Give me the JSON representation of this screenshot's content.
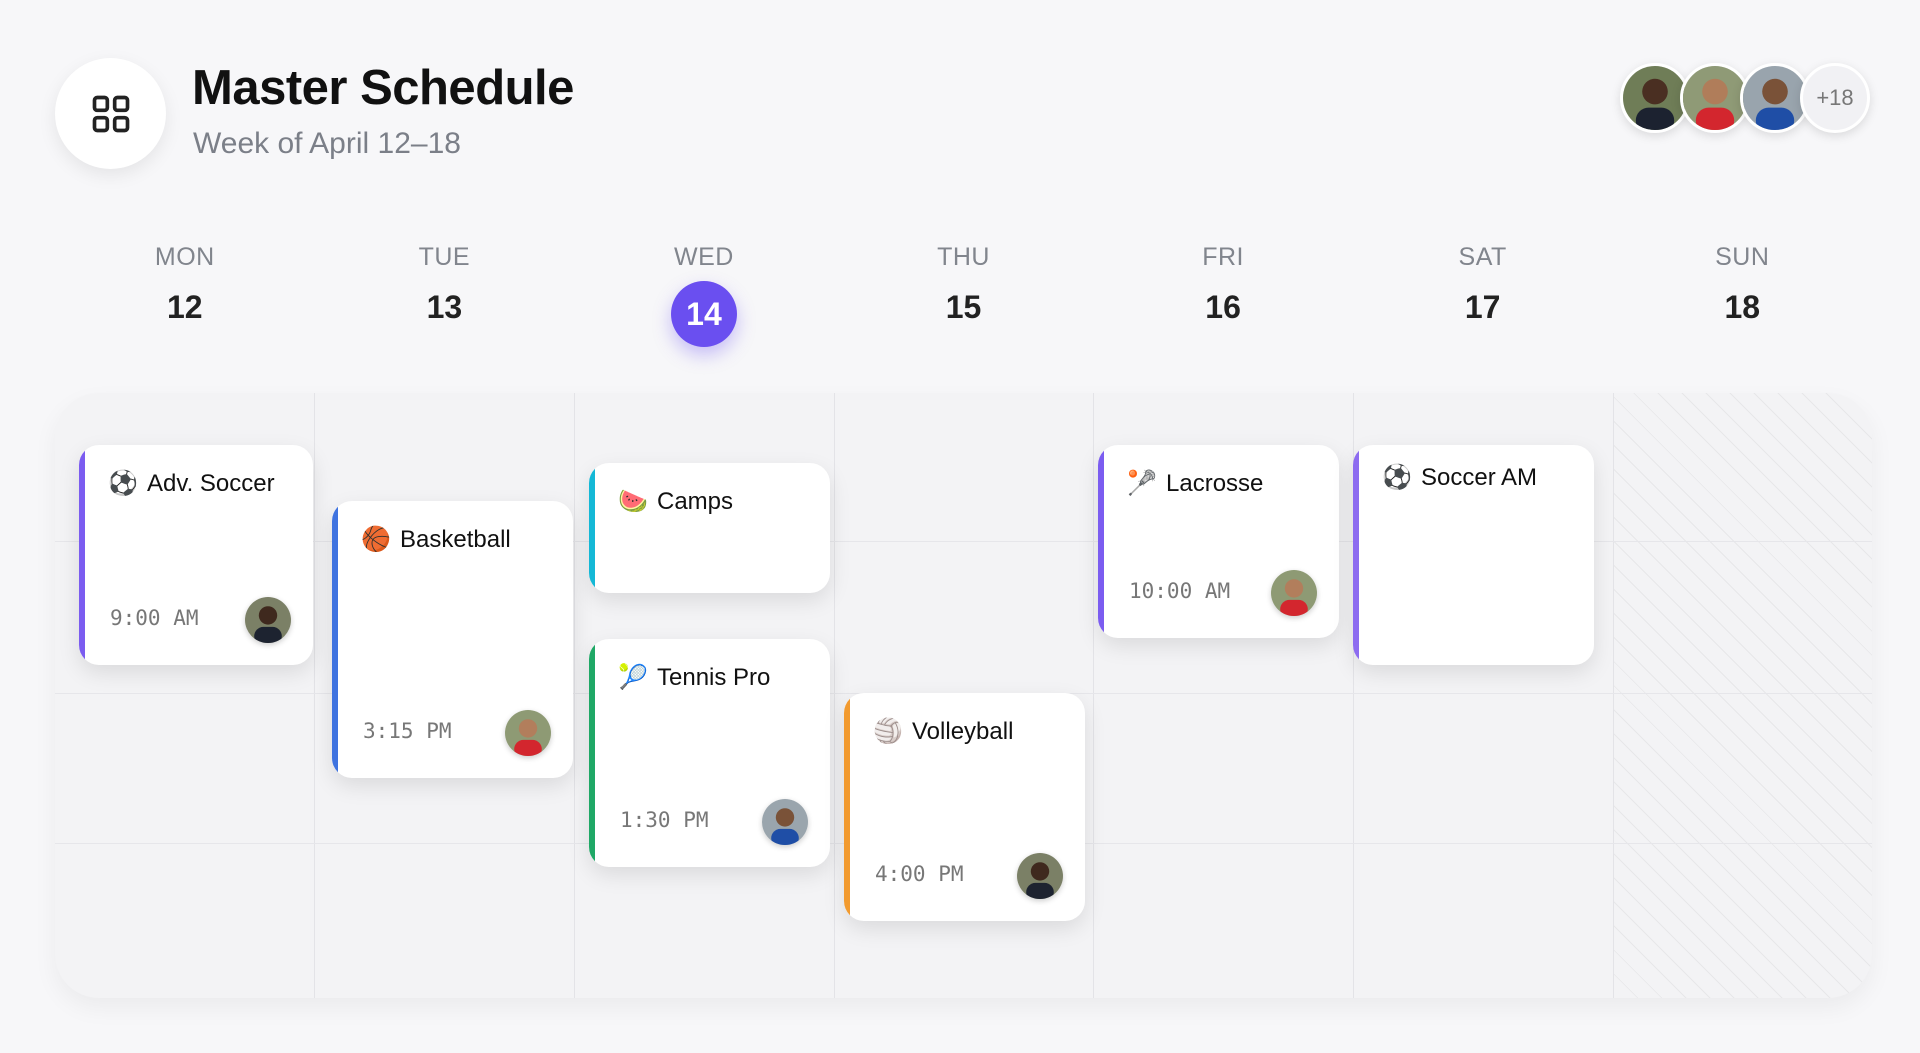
{
  "header": {
    "title": "Master Schedule",
    "subtitle": "Week of April 12–18",
    "more_count": "+18"
  },
  "colors": {
    "today": "#6a4ff0",
    "accent_purple": "#7b5cf0",
    "accent_blue": "#3f73e0",
    "accent_cyan": "#14b8d6",
    "accent_green": "#1fa866",
    "accent_orange": "#f29a2e",
    "accent_violet": "#8d6cf0"
  },
  "days": [
    {
      "name": "MON",
      "num": "12"
    },
    {
      "name": "TUE",
      "num": "13"
    },
    {
      "name": "WED",
      "num": "14"
    },
    {
      "name": "THU",
      "num": "15"
    },
    {
      "name": "FRI",
      "num": "16"
    },
    {
      "name": "SAT",
      "num": "17"
    },
    {
      "name": "SUN",
      "num": "18"
    }
  ],
  "events": {
    "adv_soccer": {
      "title": "Adv. Soccer",
      "time": "9:00 AM",
      "icon": "soccer-ball-icon"
    },
    "basketball": {
      "title": "Basketball",
      "time": "3:15 PM",
      "icon": "basketball-icon"
    },
    "camps": {
      "title": "Camps",
      "icon": "watermelon-icon"
    },
    "tennis": {
      "title": "Tennis Pro",
      "time": "1:30 PM",
      "icon": "tennis-ball-icon"
    },
    "volleyball": {
      "title": "Volleyball",
      "time": "4:00 PM",
      "icon": "volleyball-icon"
    },
    "lacrosse": {
      "title": "Lacrosse",
      "time": "10:00 AM",
      "icon": "lacrosse-stick-icon"
    },
    "soccer_am": {
      "title": "Soccer AM",
      "icon": "soccer-ball-icon"
    }
  }
}
